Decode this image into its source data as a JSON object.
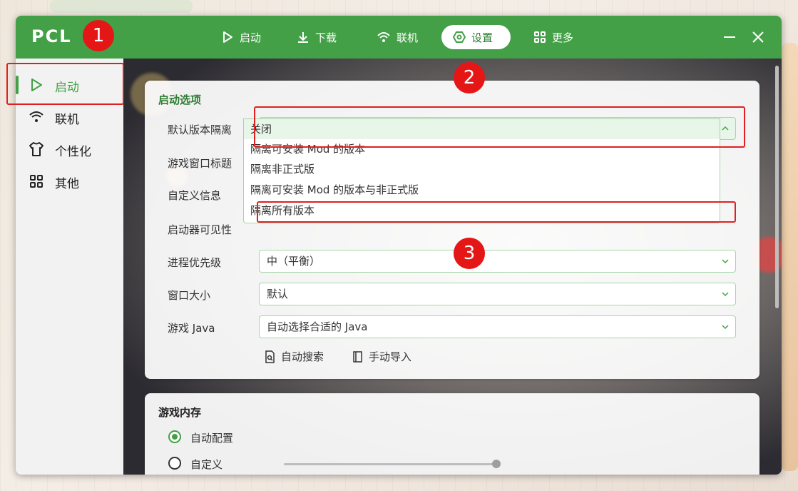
{
  "app": {
    "logo": "PCL",
    "nav": [
      {
        "label": "启动",
        "icon": "play-icon"
      },
      {
        "label": "下载",
        "icon": "download-icon"
      },
      {
        "label": "联机",
        "icon": "wifi-icon"
      },
      {
        "label": "设置",
        "icon": "settings-icon",
        "active": true
      },
      {
        "label": "更多",
        "icon": "grid-icon"
      }
    ]
  },
  "sidebar": {
    "items": [
      {
        "label": "启动",
        "icon": "play-icon",
        "active": true
      },
      {
        "label": "联机",
        "icon": "wifi-icon"
      },
      {
        "label": "个性化",
        "icon": "tshirt-icon"
      },
      {
        "label": "其他",
        "icon": "grid-icon"
      }
    ]
  },
  "launch_options": {
    "title": "启动选项",
    "rows": [
      {
        "label": "默认版本隔离",
        "value": "关闭"
      },
      {
        "label": "游戏窗口标题",
        "value": ""
      },
      {
        "label": "自定义信息",
        "value": ""
      },
      {
        "label": "启动器可见性",
        "value": ""
      },
      {
        "label": "进程优先级",
        "value": "中（平衡）"
      },
      {
        "label": "窗口大小",
        "value": "默认"
      },
      {
        "label": "游戏 Java",
        "value": "自动选择合适的 Java"
      }
    ],
    "dropdown_options": [
      "关闭",
      "隔离可安装 Mod 的版本",
      "隔离非正式版",
      "隔离可安装 Mod 的版本与非正式版",
      "隔离所有版本"
    ],
    "auto_search": "自动搜索",
    "manual_import": "手动导入"
  },
  "memory": {
    "title": "游戏内存",
    "options": [
      {
        "label": "自动配置",
        "selected": true
      },
      {
        "label": "自定义",
        "selected": false
      }
    ]
  },
  "annotations": [
    "1",
    "2",
    "3"
  ],
  "colors": {
    "accent": "#43a047",
    "accent_dark": "#2e7d32",
    "highlight": "#e02020"
  }
}
